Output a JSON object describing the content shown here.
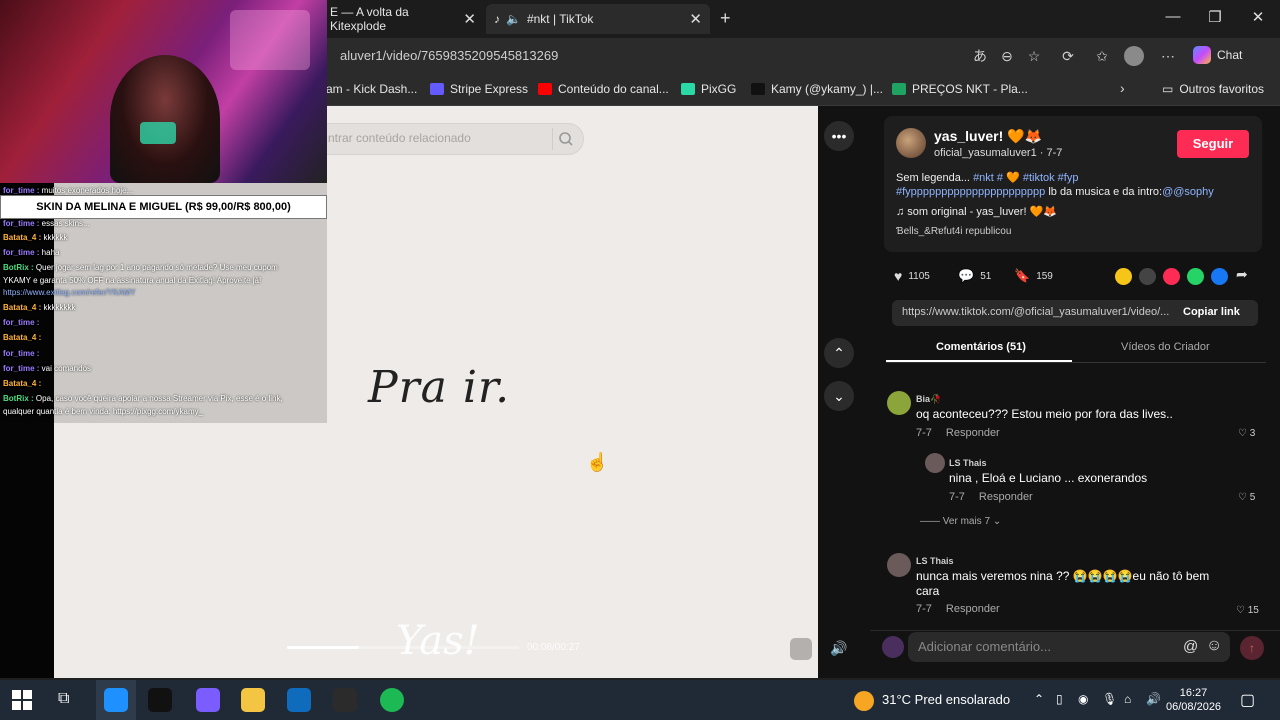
{
  "browser": {
    "tabs": [
      {
        "title": "E — A volta da Kitexplode"
      },
      {
        "title": "#nkt | TikTok"
      }
    ],
    "new_tab": "+",
    "url": "aluver1/video/7659835209545813269",
    "chat_label": "Chat",
    "favorites": [
      {
        "label": "am - Kick Dash...",
        "color": "#53fc18"
      },
      {
        "label": "Stripe Express",
        "color": "#635bff"
      },
      {
        "label": "Conteúdo do canal...",
        "color": "#ff0000"
      },
      {
        "label": "PixGG",
        "color": "#2bd9a7"
      },
      {
        "label": "Kamy (@ykamy_) |...",
        "color": "#111111"
      },
      {
        "label": "PREÇOS NKT - Pla...",
        "color": "#1ea362"
      }
    ],
    "other_favorites": "Outros favoritos"
  },
  "video": {
    "search_placeholder": "ntrar conteúdo relacionado",
    "overlay_text": "Pra ir.",
    "signature": "Yas!",
    "time": "00:08/00:27",
    "progress": 0.31
  },
  "post": {
    "author_name": "yas_luver! 🧡🦊",
    "author_handle": "oficial_yasumaluver1 · 7-7",
    "follow_label": "Seguir",
    "caption_plain1": "Sem legenda... ",
    "caption_tags1": "#nkt # 🧡 #tiktok #fyp",
    "caption_tags2": "#fypppppppppppppppppppppp",
    "caption_plain2": " lb da musica e da intro:",
    "caption_mention": "@@sophy",
    "sound": "♫  som original - yas_luver! 🧡🦊",
    "repost": "Ɓells_&Rɐfut4i republicou",
    "likes": "1105",
    "comments": "51",
    "saves": "159",
    "link": "https://www.tiktok.com/@oficial_yasumaluver1/video/...",
    "copy_link": "Copiar link",
    "tab_comments": "Comentários (51)",
    "tab_creator_videos": "Vídeos do Criador",
    "share_colors": [
      "#f5c518",
      "#444444",
      "#fe2c55",
      "#25d366",
      "#1877f2"
    ]
  },
  "comments": [
    {
      "user": "Bia🥀",
      "text": "oq aconteceu??? Estou meio por fora das lives..",
      "date": "7-7",
      "reply": "Responder",
      "likes": "3"
    },
    {
      "user": "LS Thais",
      "text": "nina , Eloá e Luciano ... exonerandos",
      "date": "7-7",
      "reply": "Responder",
      "likes": "5"
    },
    {
      "user": "LS Thais",
      "text": "nunca mais veremos nina ?? 😭😭😭😭eu não tô bem cara",
      "date": "7-7",
      "reply": "Responder",
      "likes": "15"
    }
  ],
  "view_more": "Ver mais 7",
  "comment_input_placeholder": "Adicionar comentário...",
  "overlay": {
    "banner": "SKIN DA MELINA E MIGUEL (R$ 99,00/R$ 800,00)",
    "chat": [
      {
        "user": "for_time",
        "text": "muitos exonerados hoje...",
        "color": "#9b7bff"
      },
      {
        "user": "for_time",
        "text": "essas skins...",
        "color": "#9b7bff"
      },
      {
        "user": "Batata_4",
        "text": "kkkkkk",
        "color": "#ffb43a"
      },
      {
        "user": "for_time",
        "text": "haha",
        "color": "#9b7bff"
      },
      {
        "user": "BotRix",
        "text": "Quer jogar sem lag por 1 ano pagando só metade? Use meu cupom",
        "color": "#4ade80"
      },
      {
        "user": "",
        "text": "YKAMY e garanta 50% OFF na assinatura anual da Exitlag! Aproveite já!",
        "color": "#ffffff"
      },
      {
        "user": "",
        "text": "https://www.exitlag.com/refer/YKAMY",
        "color": "#8fb4ff"
      },
      {
        "user": "Batata_4",
        "text": "kkkkkkkk",
        "color": "#ffb43a"
      },
      {
        "user": "for_time",
        "text": "",
        "color": "#9b7bff"
      },
      {
        "user": "Batata_4",
        "text": "",
        "color": "#ffb43a"
      },
      {
        "user": "for_time",
        "text": "",
        "color": "#9b7bff"
      },
      {
        "user": "for_time",
        "text": "vai comandos",
        "color": "#9b7bff"
      },
      {
        "user": "Batata_4",
        "text": "",
        "color": "#ffb43a"
      },
      {
        "user": "BotRix",
        "text": "Opa, caso você queira apoiar a nossa Streamer via Pix, esse é o link,",
        "color": "#4ade80"
      },
      {
        "user": "",
        "text": "qualquer quantia é bem vinda: https://pixgg.com/ykamy_",
        "color": "#ffffff"
      }
    ]
  },
  "taskbar": {
    "weather": "31°C  Pred ensolarado",
    "time": "16:27",
    "date": "06/08/2026",
    "apps": [
      "#1e90ff",
      "#111111",
      "#7b5cff",
      "#f4c542",
      "#0f6cbd",
      "#2b2b2b",
      "#1db954"
    ]
  }
}
